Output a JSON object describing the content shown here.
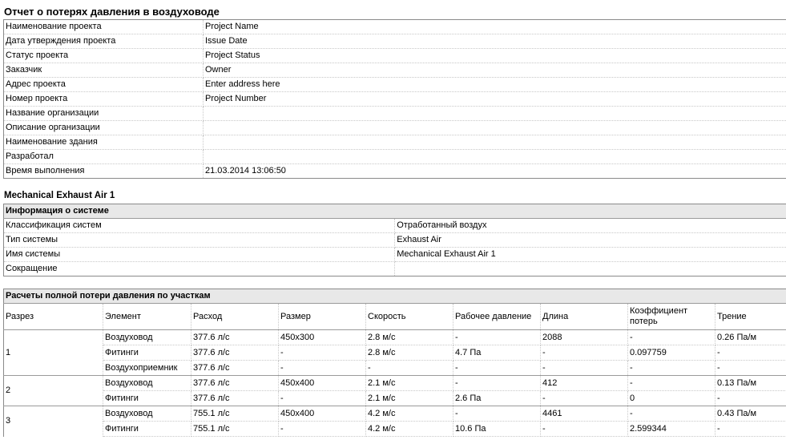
{
  "report_title": "Отчет о потерях давления в воздуховоде",
  "project_info": [
    {
      "label": "Наименование проекта",
      "value": "Project Name"
    },
    {
      "label": "Дата утверждения проекта",
      "value": "Issue Date"
    },
    {
      "label": "Статус проекта",
      "value": "Project Status"
    },
    {
      "label": "Заказчик",
      "value": "Owner"
    },
    {
      "label": "Адрес проекта",
      "value": "Enter address here"
    },
    {
      "label": "Номер проекта",
      "value": "Project Number"
    },
    {
      "label": "Название организации",
      "value": ""
    },
    {
      "label": "Описание организации",
      "value": ""
    },
    {
      "label": "Наименование здания",
      "value": ""
    },
    {
      "label": "Разработал",
      "value": ""
    },
    {
      "label": "Время выполнения",
      "value": "21.03.2014 13:06:50"
    }
  ],
  "system": {
    "title": "Mechanical Exhaust Air 1",
    "info_header": "Информация о системе",
    "rows": [
      {
        "label": "Классификация систем",
        "value": "Отработанный воздух"
      },
      {
        "label": "Тип системы",
        "value": "Exhaust Air"
      },
      {
        "label": "Имя системы",
        "value": "Mechanical Exhaust Air 1"
      },
      {
        "label": "Сокращение",
        "value": ""
      }
    ]
  },
  "calc": {
    "header": "Расчеты полной потери давления по участкам",
    "columns": [
      "Разрез",
      "Элемент",
      "Расход",
      "Размер",
      "Скорость",
      "Рабочее давление",
      "Длина",
      "Коэффициент потерь",
      "Трение"
    ],
    "sections": [
      {
        "id": "1",
        "rows": [
          [
            "Воздуховод",
            "377.6 л/с",
            "450x300",
            "2.8 м/с",
            "-",
            "2088",
            "-",
            "0.26 Па/м"
          ],
          [
            "Фитинги",
            "377.6 л/с",
            "-",
            "2.8 м/с",
            "4.7 Па",
            "-",
            "0.097759",
            "-"
          ],
          [
            "Воздухоприемник",
            "377.6 л/с",
            "-",
            "-",
            "-",
            "-",
            "-",
            "-"
          ]
        ]
      },
      {
        "id": "2",
        "rows": [
          [
            "Воздуховод",
            "377.6 л/с",
            "450x400",
            "2.1 м/с",
            "-",
            "412",
            "-",
            "0.13 Па/м"
          ],
          [
            "Фитинги",
            "377.6 л/с",
            "-",
            "2.1 м/с",
            "2.6 Па",
            "-",
            "0",
            "-"
          ]
        ]
      },
      {
        "id": "3",
        "rows": [
          [
            "Воздуховод",
            "755.1 л/с",
            "450x400",
            "4.2 м/с",
            "-",
            "4461",
            "-",
            "0.43 Па/м"
          ],
          [
            "Фитинги",
            "755.1 л/с",
            "-",
            "4.2 м/с",
            "10.6 Па",
            "-",
            "2.599344",
            "-"
          ]
        ]
      }
    ]
  }
}
